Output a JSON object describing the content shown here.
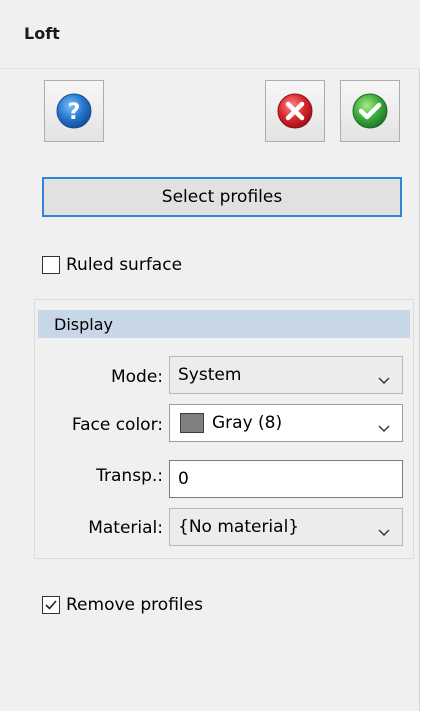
{
  "panel": {
    "title": "Loft"
  },
  "toolbar": {
    "help_icon": "help-icon",
    "cancel_icon": "cancel-icon",
    "ok_icon": "ok-icon"
  },
  "select_profiles": {
    "label": "Select profiles"
  },
  "ruled_surface": {
    "label": "Ruled surface",
    "checked": false
  },
  "display": {
    "header": "Display",
    "mode": {
      "label": "Mode:",
      "value": "System"
    },
    "face_color": {
      "label": "Face color:",
      "value": "Gray (8)",
      "swatch_color": "#808080"
    },
    "transparency": {
      "label": "Transp.:",
      "value": "0"
    },
    "material": {
      "label": "Material:",
      "value": "{No material}"
    }
  },
  "remove_profiles": {
    "label": "Remove profiles",
    "checked": true
  },
  "colors": {
    "accent": "#2f86d6",
    "group_header": "#c7d7e7",
    "help_blue": "#1f6fc7",
    "cancel_red": "#d9262b",
    "ok_green": "#3aa93a"
  }
}
